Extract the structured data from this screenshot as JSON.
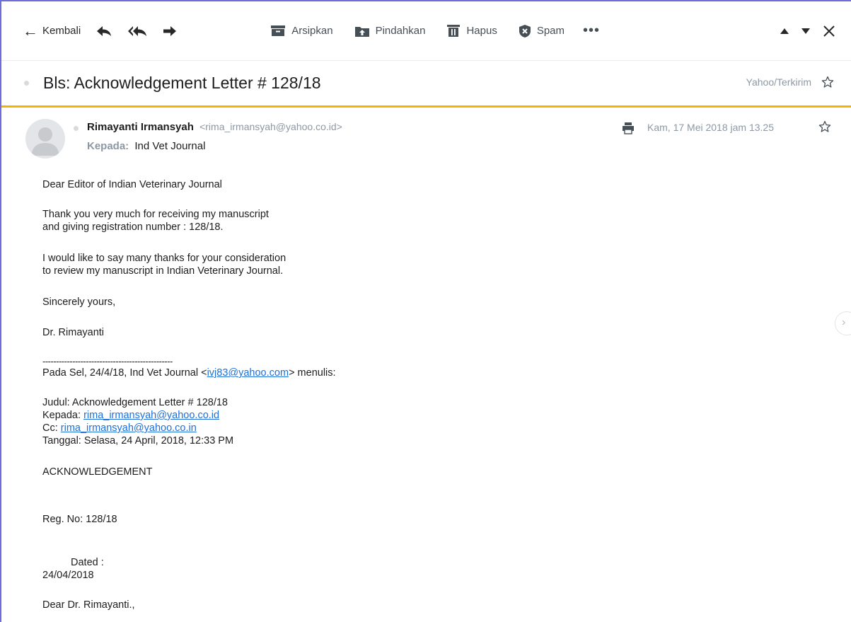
{
  "toolbar": {
    "back_label": "Kembali",
    "archive_label": "Arsipkan",
    "move_label": "Pindahkan",
    "delete_label": "Hapus",
    "spam_label": "Spam",
    "more_label": "•••"
  },
  "subject": {
    "title": "Bls: Acknowledgement Letter # 128/18",
    "folder": "Yahoo/Terkirim"
  },
  "message": {
    "sender_name": "Rimayanti Irmansyah",
    "sender_email": "<rima_irmansyah@yahoo.co.id>",
    "to_label": "Kepada:",
    "to_value": "Ind Vet Journal",
    "date": "Kam, 17 Mei 2018 jam 13.25"
  },
  "body": {
    "greeting": "Dear Editor of Indian Veterinary Journal",
    "para1_line1": "Thank you very much for receiving my manuscript",
    "para1_line2": "and giving registration number : 128/18.",
    "para2_line1": "I would like to say many thanks for your consideration",
    "para2_line2": "to review my manuscript in Indian Veterinary Journal.",
    "closing": "Sincerely yours,",
    "signature": "Dr. Rimayanti",
    "separator": "------------------------------------------------",
    "quote_intro_pre": "Pada Sel, 24/4/18, Ind Vet Journal <",
    "quote_intro_email": "ivj83@yahoo.com",
    "quote_intro_post": "> menulis:",
    "q_subject": "Judul: Acknowledgement Letter # 128/18",
    "q_to_label": "Kepada: ",
    "q_to_email": "rima_irmansyah@yahoo.co.id",
    "q_cc_label": "Cc: ",
    "q_cc_email": "rima_irmansyah@yahoo.co.in",
    "q_date": "Tanggal: Selasa, 24 April, 2018, 12:33 PM",
    "ack": "ACKNOWLEDGEMENT",
    "reg": "Reg. No: 128/18",
    "dated_label": "Dated :",
    "dated_value": "24/04/2018",
    "dear": "Dear Dr. Rimayanti.,"
  },
  "colors": {
    "accent": "#f5b300",
    "link": "#1e6fd9",
    "muted": "#8d98a4",
    "frame": "#6f6dd8"
  }
}
